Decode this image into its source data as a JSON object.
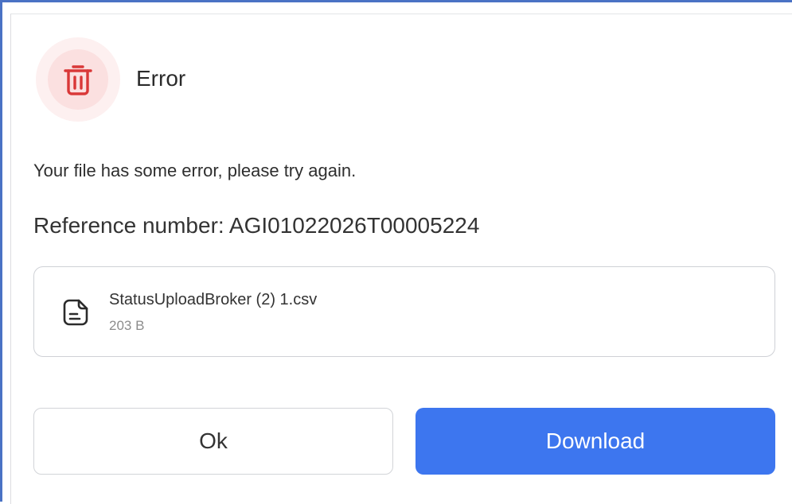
{
  "dialog": {
    "title": "Error",
    "message": "Your file has some error, please try again.",
    "reference": "Reference number: AGI01022026T00005224",
    "icon": "trash-icon",
    "accent_color": "#d93838"
  },
  "file": {
    "name": "StatusUploadBroker (2) 1.csv",
    "size": "203 B",
    "icon": "file-icon"
  },
  "actions": {
    "ok_label": "Ok",
    "download_label": "Download",
    "download_color": "#3d76ef"
  }
}
